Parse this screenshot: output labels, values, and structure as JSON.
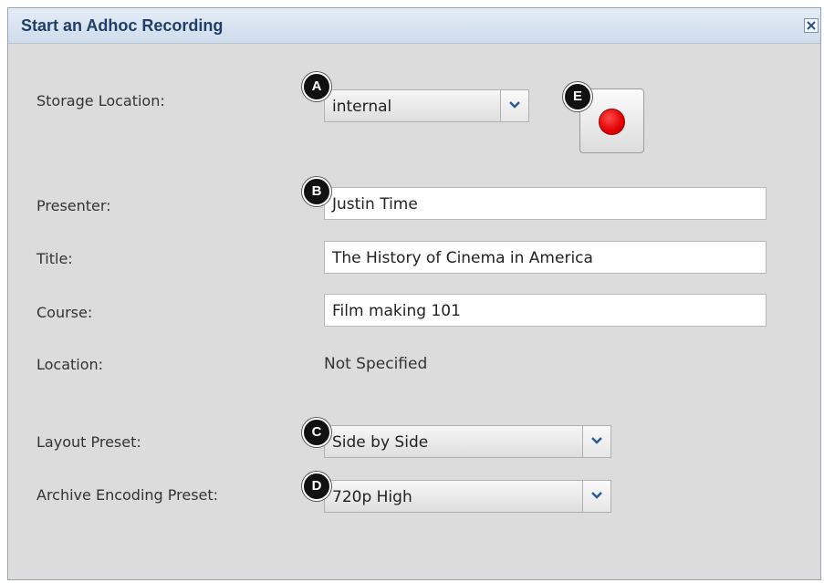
{
  "dialog": {
    "title": "Start an Adhoc Recording"
  },
  "form": {
    "storage_location": {
      "label": "Storage Location:",
      "value": "internal"
    },
    "presenter": {
      "label": "Presenter:",
      "value": "Justin Time"
    },
    "title": {
      "label": "Title:",
      "value": "The History of Cinema in America"
    },
    "course": {
      "label": "Course:",
      "value": "Film making 101"
    },
    "location": {
      "label": "Location:",
      "value": "Not Specified"
    },
    "layout_preset": {
      "label": "Layout Preset:",
      "value": "Side by Side"
    },
    "archive_preset": {
      "label": "Archive Encoding Preset:",
      "value": "720p High"
    }
  },
  "callouts": {
    "a": "A",
    "b": "B",
    "c": "C",
    "d": "D",
    "e": "E"
  },
  "icons": {
    "close": "close-icon",
    "dropdown": "chevron-down-icon",
    "record": "record-icon"
  },
  "colors": {
    "title_text": "#1f3f66",
    "record_red": "#e00000",
    "dropdown_arrow": "#2a5c9a"
  }
}
